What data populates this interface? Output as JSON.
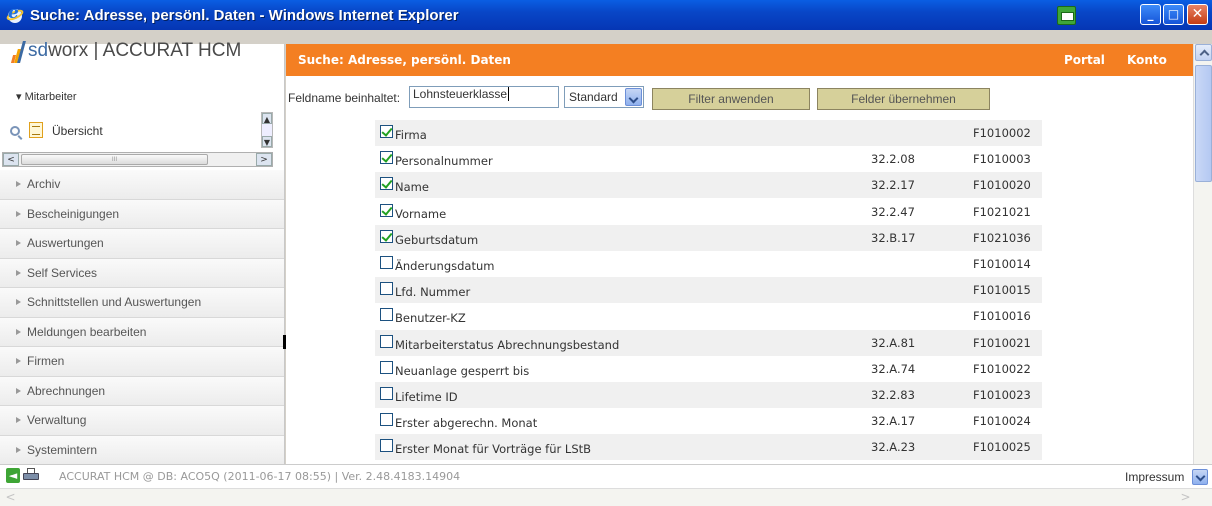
{
  "window": {
    "title": "Suche: Adresse, persönl. Daten - Windows Internet Explorer",
    "min_label": "_",
    "max_label": "□",
    "close_label": "✕"
  },
  "sidebar": {
    "brand_sd": "sd",
    "brand_rest": "worx",
    "brand_product": " | ACCURAT HCM",
    "mitarbeiter": "▾  Mitarbeiter",
    "ubersicht": "Übersicht",
    "scroll_up": "▲",
    "scroll_down": "▼",
    "scroll_left": "<",
    "scroll_right": ">",
    "scroll_grip": "III",
    "items": [
      {
        "label": "Archiv"
      },
      {
        "label": "Bescheinigungen"
      },
      {
        "label": "Auswertungen"
      },
      {
        "label": "Self Services"
      },
      {
        "label": "Schnittstellen und Auswertungen"
      },
      {
        "label": "Meldungen bearbeiten"
      },
      {
        "label": "Firmen"
      },
      {
        "label": "Abrechnungen"
      },
      {
        "label": "Verwaltung"
      },
      {
        "label": "Systemintern"
      }
    ]
  },
  "header": {
    "title": "Suche: Adresse, persönl. Daten",
    "portal": "Portal",
    "konto": "Konto"
  },
  "filter": {
    "label": "Feldname beinhaltet:",
    "value": "Lohnsteuerklasse",
    "select_value": "Standard",
    "apply_button": "Filter anwenden",
    "take_button": "Felder übernehmen"
  },
  "rows": [
    {
      "name": "Firma",
      "code": "",
      "fid": "F1010002",
      "checked": true
    },
    {
      "name": "Personalnummer",
      "code": "32.2.08",
      "fid": "F1010003",
      "checked": true
    },
    {
      "name": "Name",
      "code": "32.2.17",
      "fid": "F1010020",
      "checked": true
    },
    {
      "name": "Vorname",
      "code": "32.2.47",
      "fid": "F1021021",
      "checked": true
    },
    {
      "name": "Geburtsdatum",
      "code": "32.B.17",
      "fid": "F1021036",
      "checked": true
    },
    {
      "name": "Änderungsdatum",
      "code": "",
      "fid": "F1010014",
      "checked": false
    },
    {
      "name": "Lfd. Nummer",
      "code": "",
      "fid": "F1010015",
      "checked": false
    },
    {
      "name": "Benutzer-KZ",
      "code": "",
      "fid": "F1010016",
      "checked": false
    },
    {
      "name": "Mitarbeiterstatus Abrechnungsbestand",
      "code": "32.A.81",
      "fid": "F1010021",
      "checked": false
    },
    {
      "name": "Neuanlage gesperrt bis",
      "code": "32.A.74",
      "fid": "F1010022",
      "checked": false
    },
    {
      "name": "Lifetime ID",
      "code": "32.2.83",
      "fid": "F1010023",
      "checked": false
    },
    {
      "name": "Erster abgerechn. Monat",
      "code": "32.A.17",
      "fid": "F1010024",
      "checked": false
    },
    {
      "name": "Erster Monat für Vorträge für LStB",
      "code": "32.A.23",
      "fid": "F1010025",
      "checked": false
    }
  ],
  "footer": {
    "info": "ACCURAT HCM @ DB: ACO5Q (2011-06-17 08:55) | Ver. 2.48.4183.14904",
    "impressum": "Impressum",
    "back_glyph": "◄",
    "scroll_left": "<",
    "scroll_right": ">"
  },
  "colors": {
    "accent": "#f47f22",
    "button": "#d6d09a",
    "titlebar": "#0846c7"
  },
  "icons": [
    "ie-logo-icon",
    "print-status-icon",
    "search-icon",
    "document-icon",
    "back-icon",
    "printer-icon"
  ]
}
